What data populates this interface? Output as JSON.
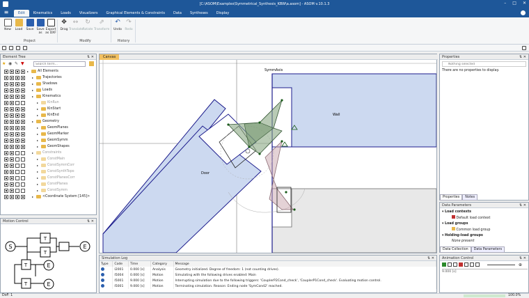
{
  "app": {
    "title": "[C:\\ASOM\\Examples\\Symmetrical_Synthesis_KBW\\a.asom] - ASOM v.10.1.3"
  },
  "menu": {
    "tabs": [
      "Edit",
      "Kinematics",
      "Loads",
      "Visualizers",
      "Graphical Elements & Constraints",
      "Data",
      "Syntheses",
      "Display"
    ],
    "active": "Edit"
  },
  "ribbon": {
    "buttons": [
      {
        "label": "New",
        "enabled": true
      },
      {
        "label": "Load",
        "enabled": true
      },
      {
        "label": "Save",
        "enabled": true
      },
      {
        "label": "Save as",
        "enabled": true
      },
      {
        "label": "Export as DXF",
        "enabled": true
      },
      {
        "label": "Drag",
        "enabled": true
      },
      {
        "label": "Translate",
        "enabled": false
      },
      {
        "label": "Rotate",
        "enabled": false
      },
      {
        "label": "Transform",
        "enabled": false
      },
      {
        "label": "Undo",
        "enabled": true
      },
      {
        "label": "Redo",
        "enabled": false
      }
    ],
    "groups": [
      "Project",
      "Modify",
      "History"
    ]
  },
  "element_tree": {
    "title": "Element Tree",
    "search_placeholder": "Search term...",
    "items": [
      {
        "label": "All Elements",
        "level": 0,
        "dim": false
      },
      {
        "label": "Trajectories",
        "level": 1,
        "dim": false
      },
      {
        "label": "Shadows",
        "level": 1,
        "dim": false
      },
      {
        "label": "Loads",
        "level": 1,
        "dim": false
      },
      {
        "label": "Kinematics",
        "level": 1,
        "dim": false
      },
      {
        "label": "KinRun",
        "level": 2,
        "dim": true
      },
      {
        "label": "KinStart",
        "level": 2,
        "dim": false
      },
      {
        "label": "KinEnd",
        "level": 2,
        "dim": false
      },
      {
        "label": "Geometry",
        "level": 1,
        "dim": false
      },
      {
        "label": "GeomPlanes",
        "level": 2,
        "dim": false
      },
      {
        "label": "GeomMarker",
        "level": 2,
        "dim": false
      },
      {
        "label": "GeomSymm",
        "level": 2,
        "dim": false
      },
      {
        "label": "GeomShapes",
        "level": 2,
        "dim": false
      },
      {
        "label": "Constraints",
        "level": 1,
        "dim": true
      },
      {
        "label": "ConstMain",
        "level": 2,
        "dim": true
      },
      {
        "label": "ConstSymmCorr",
        "level": 2,
        "dim": true
      },
      {
        "label": "ConstSynthTopo",
        "level": 2,
        "dim": true
      },
      {
        "label": "ConstPlanesCorr",
        "level": 2,
        "dim": true
      },
      {
        "label": "ConstPlanes",
        "level": 2,
        "dim": true
      },
      {
        "label": "ConstSymm",
        "level": 2,
        "dim": true
      },
      {
        "label": "<Coordinate System [145]>",
        "level": 1,
        "dim": false
      }
    ]
  },
  "motion_control": {
    "title": "Motion Control",
    "nodes": [
      "S",
      "T",
      "T",
      "T",
      "T",
      "E",
      "E",
      "E"
    ]
  },
  "canvas": {
    "tab": "Canvas",
    "labels": {
      "symaxis": "SymmAxis",
      "wall": "Wall",
      "door": "Door"
    }
  },
  "sim_log": {
    "title": "Simulation Log",
    "columns": [
      "Type",
      "Code",
      "Time",
      "Category",
      "Message"
    ],
    "rows": [
      [
        "",
        "I2001",
        "0.000 [s]",
        "Analysis",
        "Geometry initialized. Degree of freedom: 1 (not counting drives)."
      ],
      [
        "",
        "I5004",
        "0.000 [s]",
        "Motion",
        "Simulating with the following drives enabled: Main"
      ],
      [
        "",
        "I5001",
        "9.000 [s]",
        "Motion",
        "Interrupting simulation due to the following triggers: 'CouplerP2Cond_check', 'CouplerP1Cond_check'. Evaluating motion control."
      ],
      [
        "",
        "I5001",
        "9.000 [s]",
        "Motion",
        "Terminating simulation. Reason: Ending node 'SymCond2' reached."
      ]
    ]
  },
  "properties": {
    "title": "Properties",
    "search_placeholder": "Nothing selected",
    "empty_msg": "There are no properties to display.",
    "tabs": [
      "Properties",
      "Notes"
    ]
  },
  "data_params": {
    "title": "Data Parameters",
    "sections": [
      {
        "label": "Load contexts",
        "items": [
          "Default load context"
        ]
      },
      {
        "label": "Load groups",
        "items": [
          "Common load group"
        ]
      },
      {
        "label": "Holding-load groups",
        "items": [
          "None present"
        ]
      }
    ],
    "tabs": [
      "Data Collection",
      "Data Parameters"
    ]
  },
  "animation": {
    "title": "Animation Control",
    "time": "9.000 [s]"
  },
  "status": {
    "left": "DoF: 1",
    "zoom": "100.0%"
  },
  "colors": {
    "titlebar": "#1e5799",
    "canvas_fill": "#ccd9f0",
    "canvas_stroke": "#1c1c8c",
    "green_fill": "#8aa884",
    "tab_active": "#f2c060"
  }
}
